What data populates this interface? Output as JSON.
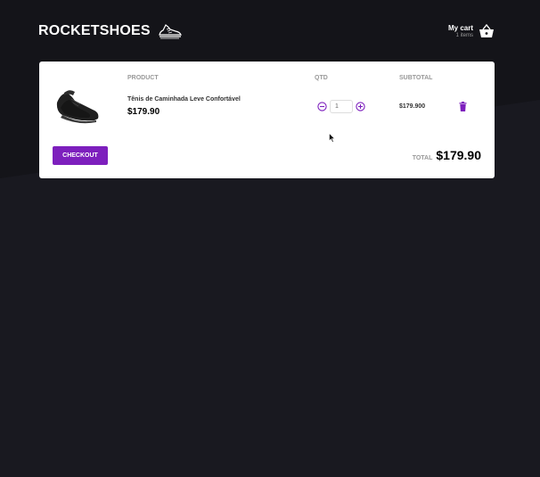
{
  "header": {
    "brand": "ROCKETSHOES",
    "cart_title": "My cart",
    "cart_count": "1 items"
  },
  "table": {
    "columns": [
      "PRODUCT",
      "QTD",
      "SUBTOTAL"
    ]
  },
  "items": [
    {
      "title": "Tênis de Caminhada Leve Confortável",
      "price": "$179.90",
      "quantity": "1",
      "subtotal": "$179.900"
    }
  ],
  "footer": {
    "checkout_label": "CHECKOUT",
    "total_label": "TOTAL",
    "total_value": "$179.90"
  },
  "colors": {
    "accent": "#7d1fbd",
    "background": "#191920"
  },
  "icons": [
    "sneaker-logo-icon",
    "shopping-basket-icon",
    "minus-circle-icon",
    "plus-circle-icon",
    "trash-icon",
    "mouse-cursor-icon"
  ]
}
